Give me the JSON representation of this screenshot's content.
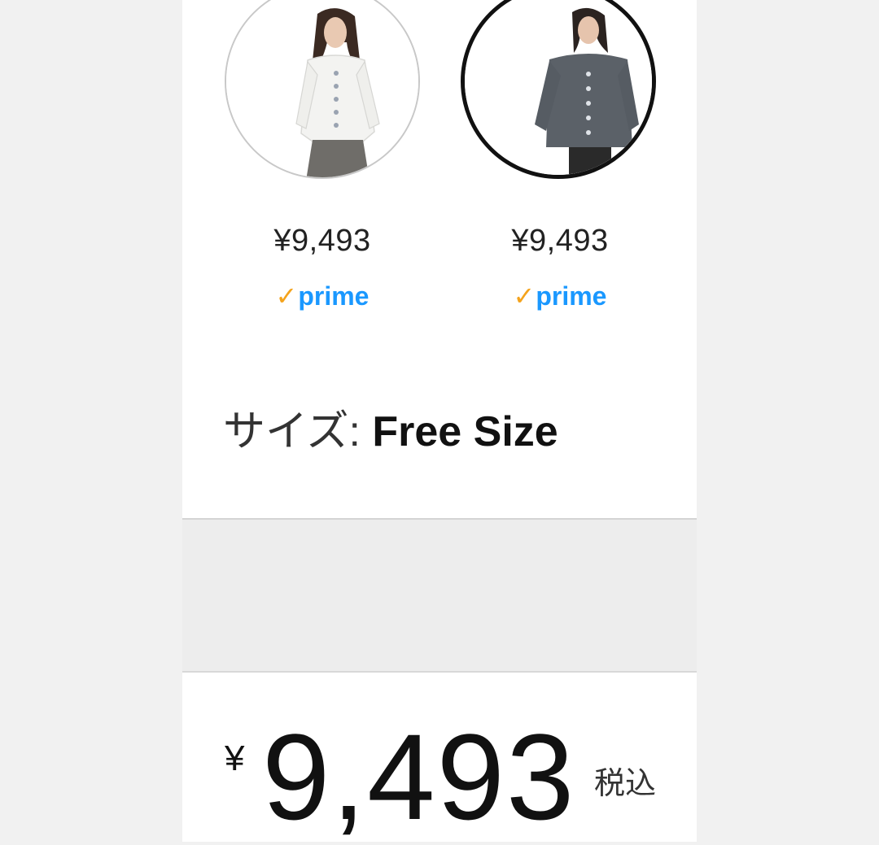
{
  "variants": [
    {
      "price": "¥9,493",
      "prime_check": "✓",
      "prime_label": "prime",
      "selected": false,
      "color": "#f4f4f4"
    },
    {
      "price": "¥9,493",
      "prime_check": "✓",
      "prime_label": "prime",
      "selected": true,
      "color": "#5b6168"
    }
  ],
  "size": {
    "label": "サイズ: ",
    "value": "Free Size"
  },
  "price": {
    "currency": "¥",
    "amount": "9,493",
    "tax_note": "税込"
  },
  "colors": {
    "prime_blue": "#1a98ff",
    "prime_orange": "#f4a31c"
  }
}
